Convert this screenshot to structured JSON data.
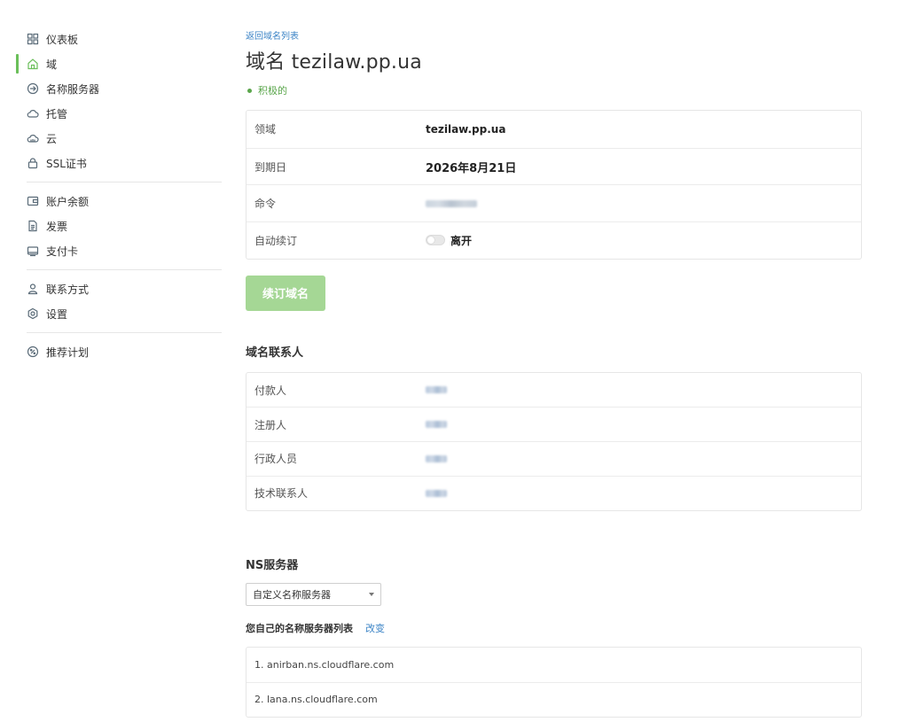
{
  "sidebar": {
    "groups": [
      [
        {
          "label": "仪表板",
          "icon": "grid-icon"
        },
        {
          "label": "域",
          "icon": "home-icon",
          "active": true
        },
        {
          "label": "名称服务器",
          "icon": "arrow-circle-icon"
        },
        {
          "label": "托管",
          "icon": "cloud-icon"
        },
        {
          "label": "云",
          "icon": "cloud-server-icon"
        },
        {
          "label": "SSL证书",
          "icon": "lock-icon"
        }
      ],
      [
        {
          "label": "账户余额",
          "icon": "wallet-icon"
        },
        {
          "label": "发票",
          "icon": "document-icon"
        },
        {
          "label": "支付卡",
          "icon": "card-icon"
        }
      ],
      [
        {
          "label": "联系方式",
          "icon": "user-icon"
        },
        {
          "label": "设置",
          "icon": "gear-icon"
        }
      ],
      [
        {
          "label": "推荐计划",
          "icon": "percent-icon"
        }
      ]
    ]
  },
  "main": {
    "back_link": "返回域名列表",
    "title": "域名 tezilaw.pp.ua",
    "status": "积极的",
    "status_color": "#5aa64b",
    "info": {
      "domain_label": "领域",
      "domain_value": "tezilaw.pp.ua",
      "expiry_label": "到期日",
      "expiry_value": "2026年8月21日",
      "order_label": "命令",
      "autorenew_label": "自动续订",
      "autorenew_value": "离开"
    },
    "renew_button": "续订域名",
    "contacts": {
      "title": "域名联系人",
      "rows": [
        {
          "label": "付款人"
        },
        {
          "label": "注册人"
        },
        {
          "label": "行政人员"
        },
        {
          "label": "技术联系人"
        }
      ]
    },
    "ns": {
      "title": "NS服务器",
      "select_value": "自定义名称服务器",
      "list_title": "您自己的名称服务器列表",
      "change_link": "改变",
      "servers": [
        "1. anirban.ns.cloudflare.com",
        "2. lana.ns.cloudflare.com"
      ]
    }
  },
  "colors": {
    "accent_green": "#6bbf5a",
    "button_green": "#a5d795",
    "link_blue": "#3c84c6"
  }
}
